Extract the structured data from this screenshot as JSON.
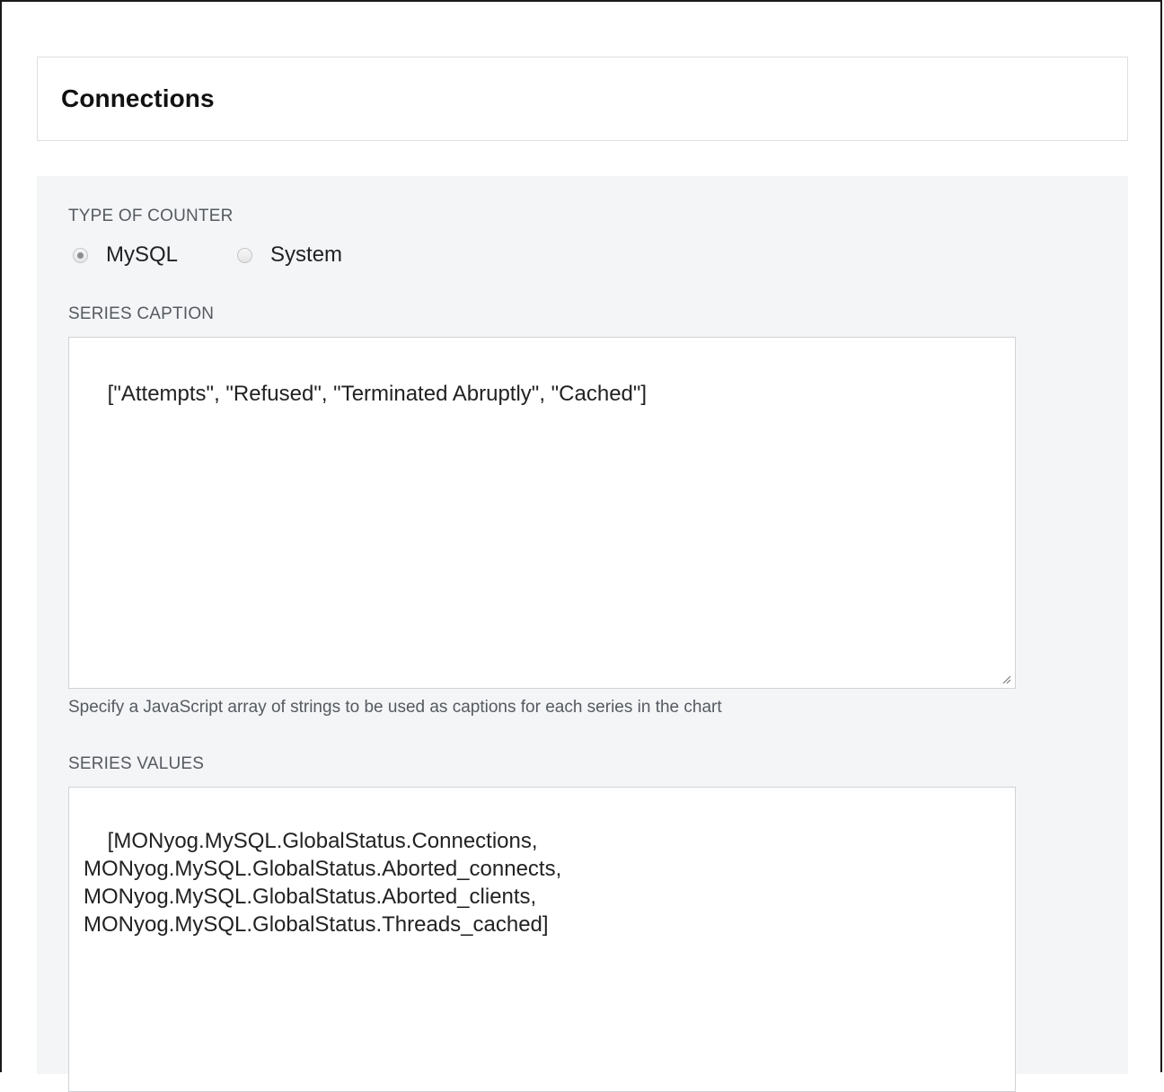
{
  "header": {
    "title": "Connections"
  },
  "form": {
    "counter_type": {
      "label": "TYPE OF COUNTER",
      "options": [
        {
          "label": "MySQL",
          "selected": true
        },
        {
          "label": "System",
          "selected": false
        }
      ]
    },
    "series_caption": {
      "label": "SERIES CAPTION",
      "value": "[\"Attempts\", \"Refused\", \"Terminated Abruptly\", \"Cached\"]",
      "help": "Specify a JavaScript array of strings to be used as captions for each series in the chart"
    },
    "series_values": {
      "label": "SERIES VALUES",
      "value": "[MONyog.MySQL.GlobalStatus.Connections,\nMONyog.MySQL.GlobalStatus.Aborted_connects,\nMONyog.MySQL.GlobalStatus.Aborted_clients,\nMONyog.MySQL.GlobalStatus.Threads_cached]"
    }
  }
}
